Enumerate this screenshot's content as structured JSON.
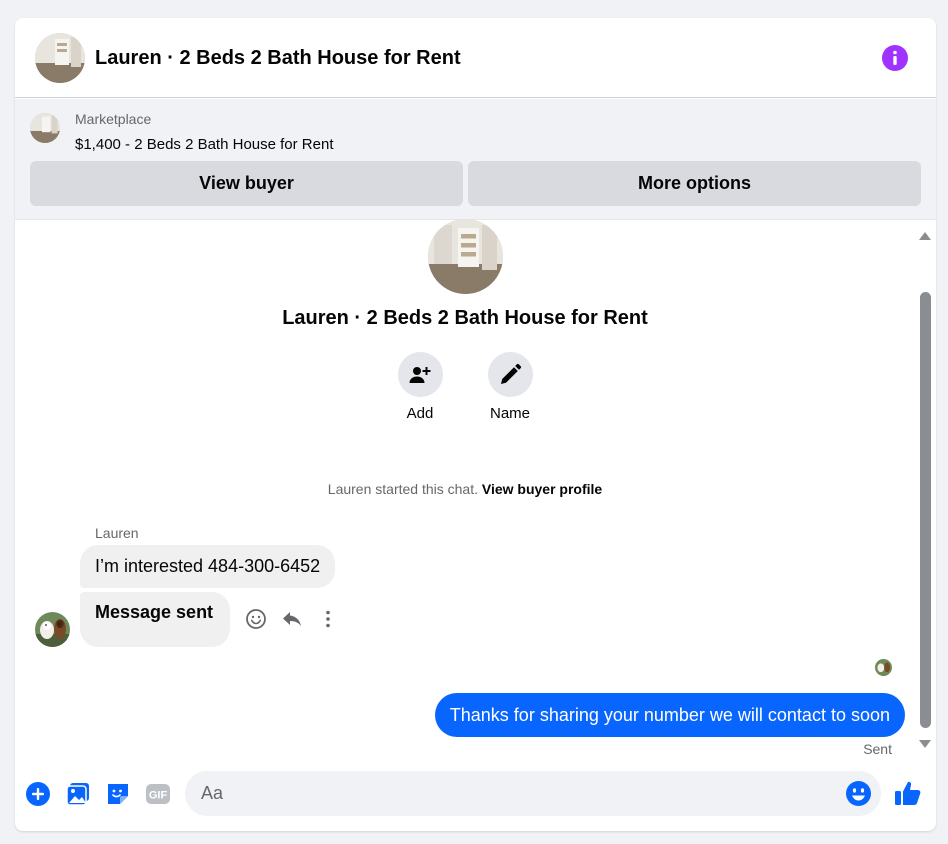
{
  "header": {
    "title": "Lauren · 2 Beds 2 Bath House for Rent"
  },
  "marketplace": {
    "label": "Marketplace",
    "listing": "$1,400 - 2 Beds 2 Bath House for Rent",
    "view_buyer_label": "View buyer",
    "more_options_label": "More options"
  },
  "profile": {
    "title": "Lauren · 2 Beds 2 Bath House for Rent",
    "add_label": "Add",
    "name_label": "Name"
  },
  "thread": {
    "started_text": "Lauren started this chat.",
    "view_profile_link": "View buyer profile",
    "sender_name": "Lauren",
    "incoming": [
      "I’m interested 484-300-6452",
      "Message sent"
    ],
    "outgoing": "Thanks for sharing your number we will contact to soon",
    "status": "Sent"
  },
  "composer": {
    "placeholder": "Aa",
    "gif_label": "GIF"
  },
  "colors": {
    "accent_blue": "#0866ff",
    "info_purple": "#a033ff",
    "bubble_gray": "#f0f0f0"
  },
  "icons": {
    "info": "info-icon",
    "add_person": "add-person-icon",
    "pencil": "pencil-icon",
    "emoji_react": "smiley-icon",
    "reply": "reply-icon",
    "more": "more-vertical-icon",
    "plus": "plus-circle-icon",
    "photo": "photo-icon",
    "sticker": "sticker-icon",
    "gif": "gif-icon",
    "emoji": "emoji-icon",
    "like": "thumbs-up-icon"
  }
}
